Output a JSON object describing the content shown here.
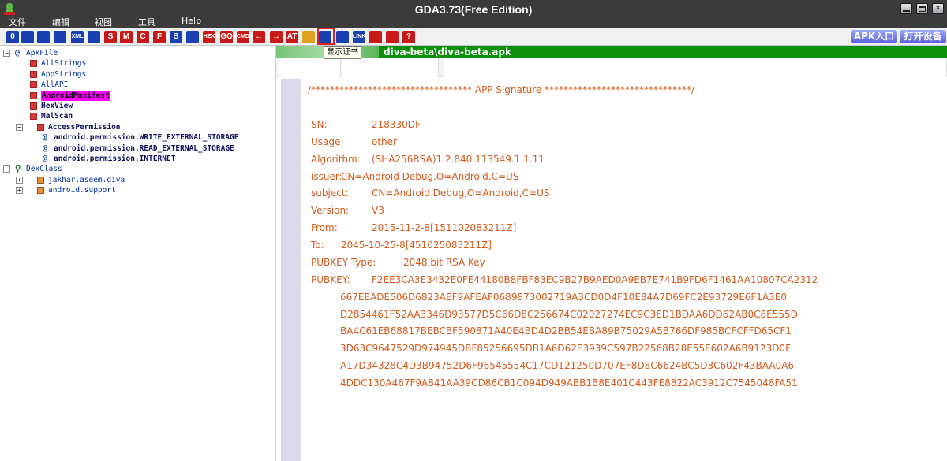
{
  "window": {
    "title": "GDA3.73(Free Edition)"
  },
  "menu": [
    "文件",
    "编辑",
    "视图",
    "工具",
    "Help"
  ],
  "toolbar": {
    "buttons": [
      {
        "icon": "open-icon",
        "label": "0",
        "color": "#1a3fb0"
      },
      {
        "icon": "save-icon",
        "label": "",
        "color": "#1a3fb0"
      },
      {
        "icon": "search-icon",
        "label": "",
        "color": "#1a3fb0"
      },
      {
        "icon": "view-icon",
        "label": "",
        "color": "#1a3fb0"
      },
      {
        "icon": "xml-icon",
        "label": "XML",
        "color": "#1a3fb0"
      },
      {
        "icon": "android-icon",
        "label": "",
        "color": "#1a3fb0"
      },
      {
        "icon": "string-icon",
        "label": "S",
        "color": "#c81818"
      },
      {
        "icon": "method-icon",
        "label": "M",
        "color": "#c81818"
      },
      {
        "icon": "class-icon",
        "label": "C",
        "color": "#c81818"
      },
      {
        "icon": "field-icon",
        "label": "F",
        "color": "#c81818"
      },
      {
        "icon": "bytecode-icon",
        "label": "B",
        "color": "#1a3fb0"
      },
      {
        "icon": "hash-icon",
        "label": "",
        "color": "#1a3fb0"
      },
      {
        "icon": "hex-icon",
        "label": "HEX",
        "color": "#c81818"
      },
      {
        "icon": "goto-icon",
        "label": "GO",
        "color": "#c81818"
      },
      {
        "icon": "cmd-icon",
        "label": "CMD",
        "color": "#c81818"
      },
      {
        "icon": "back-icon",
        "label": "←",
        "color": "#c81818"
      },
      {
        "icon": "forward-icon",
        "label": "→",
        "color": "#c81818"
      },
      {
        "icon": "at-icon",
        "label": "AT",
        "color": "#c81818"
      },
      {
        "icon": "malscan-icon",
        "label": "",
        "color": "#e0a020"
      },
      {
        "icon": "certificate-icon",
        "label": "",
        "color": "#1a3fb0"
      },
      {
        "icon": "device-icon",
        "label": "",
        "color": "#1a3fb0"
      },
      {
        "icon": "link-icon",
        "label": "LINK",
        "color": "#1a3fb0"
      },
      {
        "icon": "refresh-icon",
        "label": "",
        "color": "#c81818"
      },
      {
        "icon": "plugin-icon",
        "label": "",
        "color": "#c81818"
      },
      {
        "icon": "help-icon",
        "label": "?",
        "color": "#c81818"
      }
    ],
    "tooltip": "显示证书",
    "apk_entry": "APK入口",
    "open_device": "打开设备"
  },
  "tree": [
    {
      "label": "ApkFile",
      "type": "root",
      "expander": "−",
      "icon": "at"
    },
    {
      "label": "AllStrings",
      "type": "leaf",
      "icon": "red",
      "style": "blue"
    },
    {
      "label": "AppStrings",
      "type": "leaf",
      "icon": "red",
      "style": "blue"
    },
    {
      "label": "AllAPI",
      "type": "leaf",
      "icon": "red",
      "style": "blue"
    },
    {
      "label": "AndroidManifest",
      "type": "leaf",
      "icon": "red",
      "style": "pink"
    },
    {
      "label": "HexView",
      "type": "leaf",
      "icon": "red",
      "style": "dark"
    },
    {
      "label": "MalScan",
      "type": "leaf",
      "icon": "red",
      "style": "dark"
    },
    {
      "label": "AccessPermission",
      "type": "branch",
      "expander": "−",
      "icon": "red",
      "style": "dark"
    },
    {
      "label": "android.permission.WRITE_EXTERNAL_STORAGE",
      "type": "perm",
      "icon": "at",
      "style": "dark"
    },
    {
      "label": "android.permission.READ_EXTERNAL_STORAGE",
      "type": "perm",
      "icon": "at",
      "style": "dark"
    },
    {
      "label": "android.permission.INTERNET",
      "type": "perm",
      "icon": "at",
      "style": "dark"
    },
    {
      "label": "DexClass",
      "type": "root",
      "expander": "−",
      "icon": "dex"
    },
    {
      "label": "jakhar.aseem.diva",
      "type": "pkg",
      "expander": "+",
      "icon": "orange",
      "style": "blue"
    },
    {
      "label": "android.support",
      "type": "pkg",
      "expander": "+",
      "icon": "orange",
      "style": "blue"
    }
  ],
  "tab": {
    "title": "diva-beta\\diva-beta.apk"
  },
  "signature": {
    "header": "/********************************** APP Signature *******************************/",
    "sn_label": "SN:",
    "sn_value": "218330DF",
    "usage_label": "Usage:",
    "usage_value": "other",
    "algorithm_label": "Algorithm:",
    "algorithm_value": "(SHA256RSA)1.2.840.113549.1.1.11",
    "issuer_label": "issuer:",
    "issuer_value": "CN=Android Debug,O=Android,C=US",
    "subject_label": "subject:",
    "subject_value": "CN=Android Debug,O=Android,C=US",
    "version_label": "Version:",
    "version_value": "V3",
    "from_label": "From:",
    "from_value": "2015-11-2-8[151102083211Z]",
    "to_label": "To:",
    "to_value": "2045-10-25-8[451025083211Z]",
    "pubkey_type_label": "PUBKEY Type:",
    "pubkey_type_value": "2048 bit RSA Key",
    "pubkey_label": "PUBKEY:",
    "pubkey_lines": [
      "F2EE3CA3E3432E0FE44180B8FBF83EC9B27B9AED0A9EB7E741B9FD6F1461AA10807CA2312",
      "667EEADE506D6823AEF9AFEAF0689873002719A3CD0D4F10E84A7D69FC2E93729E6F1A3E0",
      "D2854461F52AA3346D93577D5C66D8C256674C02027274EC9C3ED1BDAA6DD62AB0C8E555D",
      "BA4C61EB68817BEBCBF590871A40E4BD4D2BB54EBA89B75029A5B766DF985BCFCFFD65CF1",
      "3D63C9647529D974945DBF85256695DB1A6D62E3939C597B22568B28E55E602A6B9123D0F",
      "A17D34328C4D3B94752D6F96545554C17CD121250D707EF8D8C6624BC5D3C602F43BAA0A6",
      "4DDC130A467F9A841AA39CD86CB1C094D949ABB1B8E401C443FE8822AC3912C7545048FA51"
    ]
  }
}
